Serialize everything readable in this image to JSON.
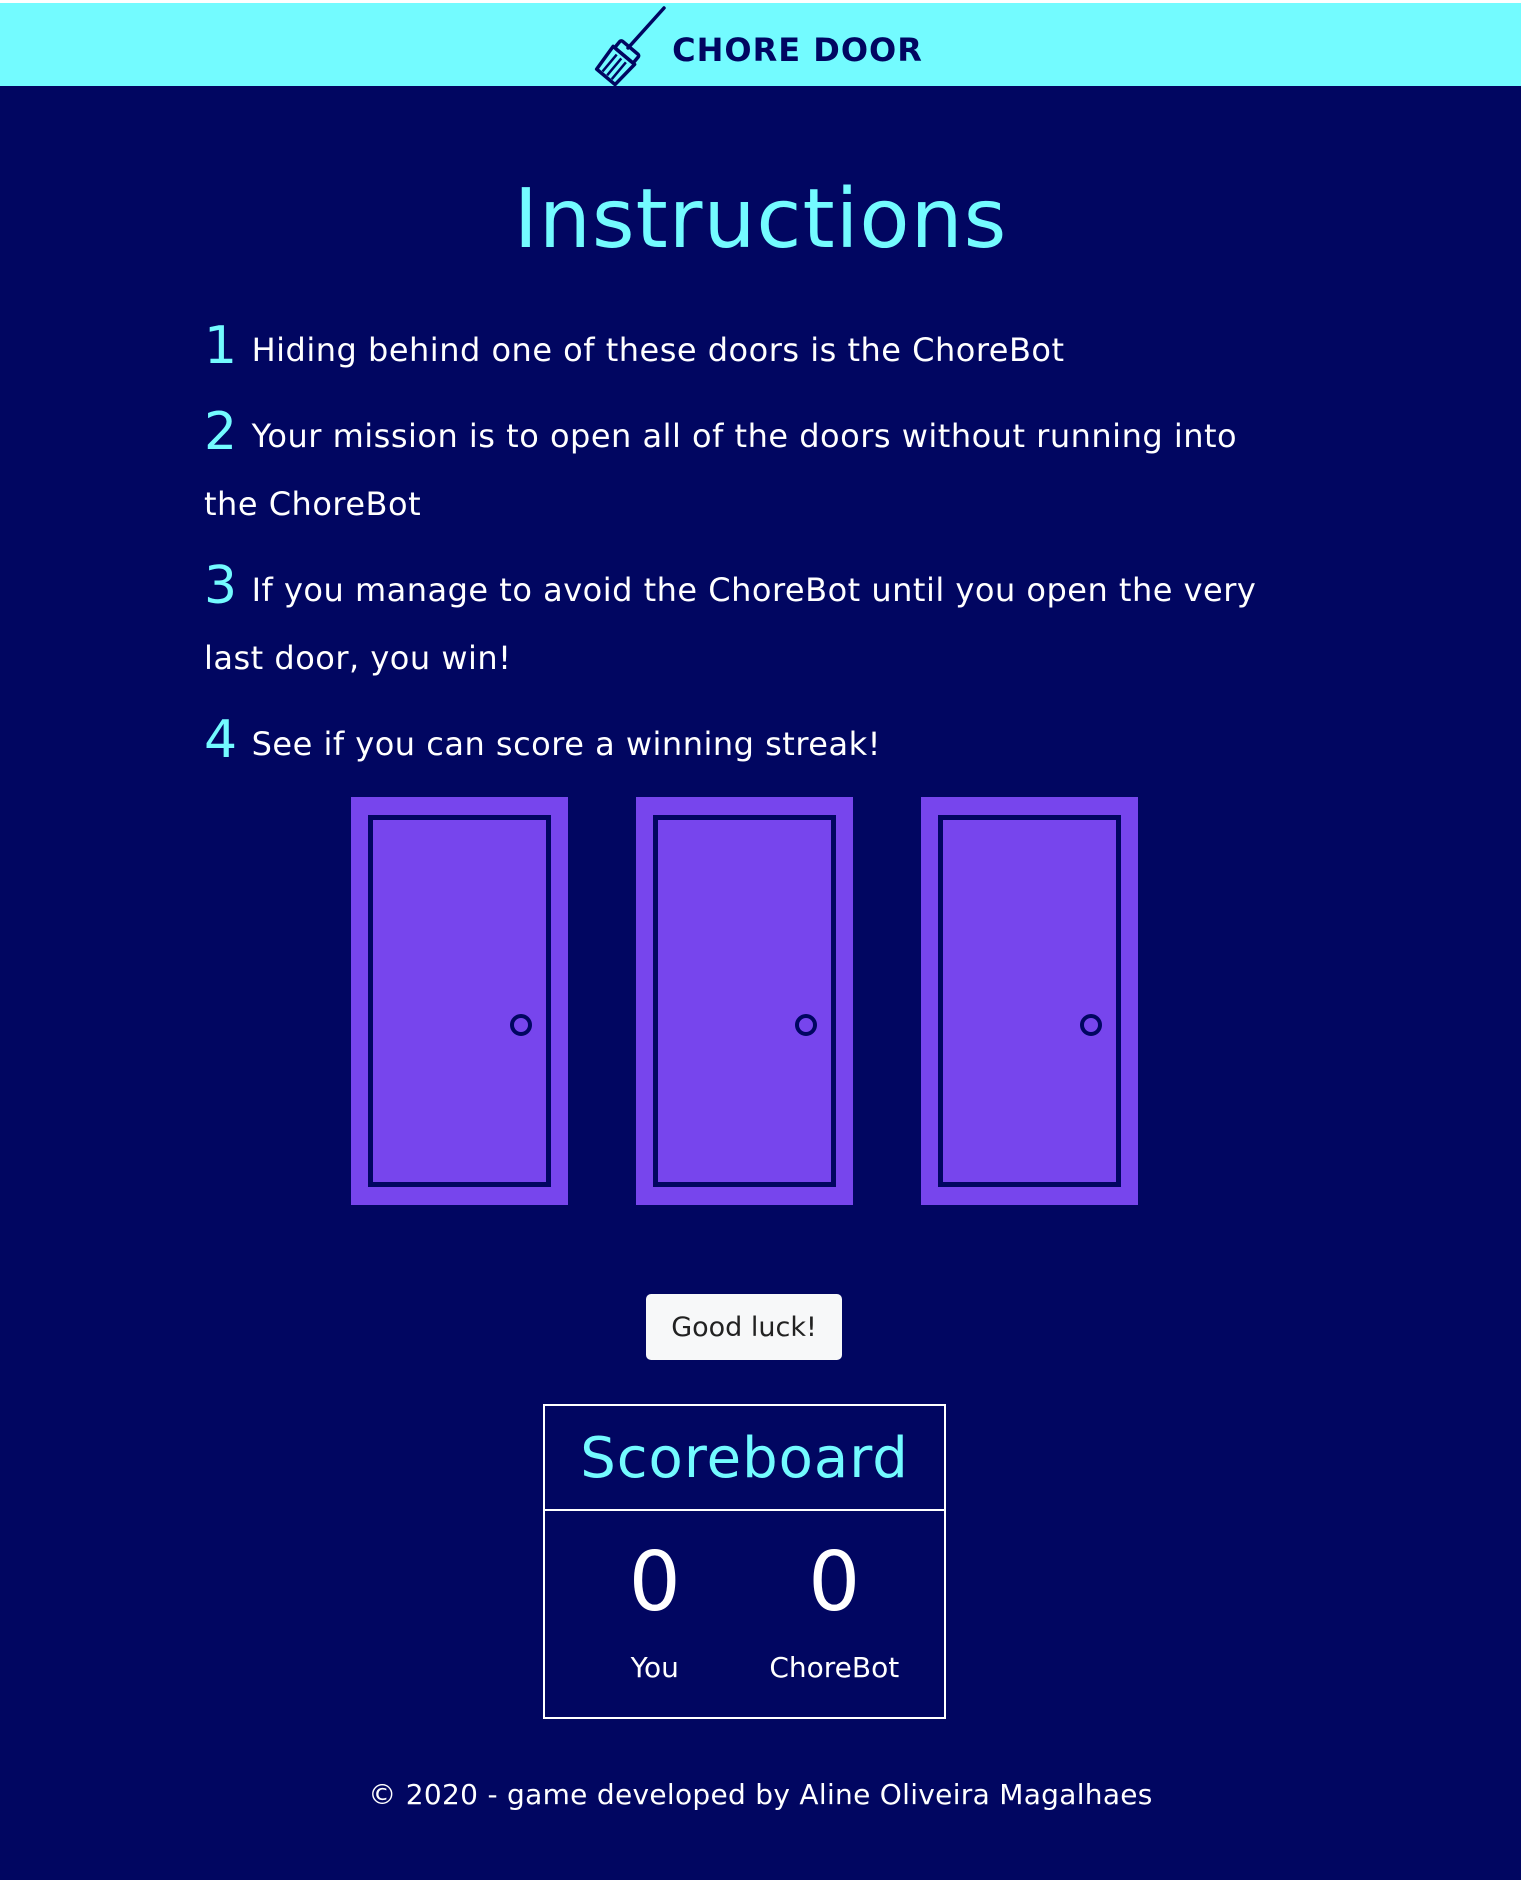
{
  "header": {
    "brand_text": "CHORE DOOR",
    "logo_icon": "broom-icon",
    "background_color": "#73fbff"
  },
  "instructions": {
    "title": "Instructions",
    "steps": [
      {
        "num": "1",
        "text": "Hiding behind one of these doors is the ChoreBot"
      },
      {
        "num": "2",
        "text": "Your mission is to open all of the doors without running into the ChoreBot"
      },
      {
        "num": "3",
        "text": "If you manage to avoid the ChoreBot until you open the very last door, you win!"
      },
      {
        "num": "4",
        "text": "See if you can score a winning streak!"
      }
    ]
  },
  "doors": {
    "count": 3,
    "door_color": "#7745ed",
    "icon": "closed-door-icon"
  },
  "start_button": {
    "label": "Good luck!"
  },
  "scoreboard": {
    "title": "Scoreboard",
    "players": [
      {
        "score": "0",
        "label": "You"
      },
      {
        "score": "0",
        "label": "ChoreBot"
      }
    ]
  },
  "footer": {
    "text": "© 2020 - game developed by Aline Oliveira Magalhaes"
  },
  "colors": {
    "background": "#010661",
    "accent": "#73fbff",
    "text": "#ffffff"
  }
}
